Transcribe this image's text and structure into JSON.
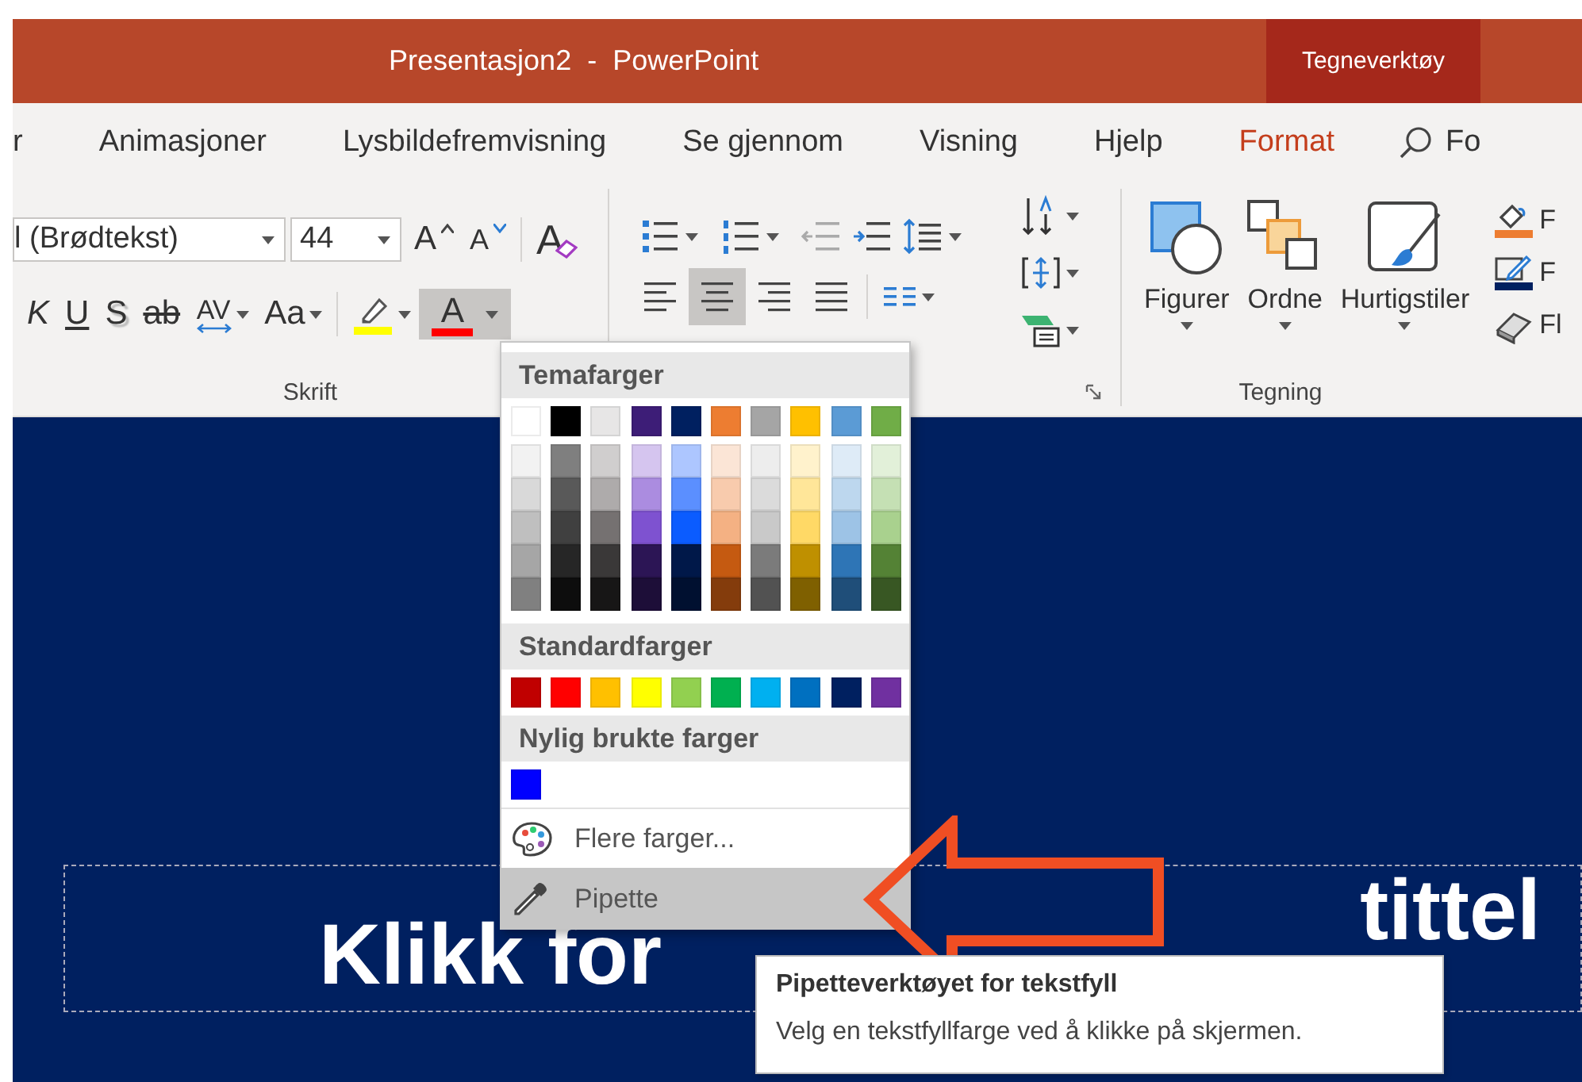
{
  "title_bar": {
    "title": "Presentasjon2  -  PowerPoint",
    "context_tab": "Tegneverktøy"
  },
  "tabs": [
    {
      "label": "r",
      "selected": false
    },
    {
      "label": "Animasjoner",
      "selected": false
    },
    {
      "label": "Lysbildefremvisning",
      "selected": false
    },
    {
      "label": "Se gjennom",
      "selected": false
    },
    {
      "label": "Visning",
      "selected": false
    },
    {
      "label": "Hjelp",
      "selected": false
    },
    {
      "label": "Format",
      "selected": true
    }
  ],
  "search": {
    "label": "Fo"
  },
  "font_group": {
    "label": "Skrift",
    "font_name": "l (Brødtekst)",
    "font_size": "44",
    "size_buttons": [
      {
        "kind": "grow",
        "text": "A"
      },
      {
        "kind": "shrink",
        "text": "A"
      }
    ],
    "clear_button": {
      "text": "A"
    },
    "format_buttons": [
      {
        "kind": "italic",
        "text": "K"
      },
      {
        "kind": "underline",
        "text": "U"
      },
      {
        "kind": "shadow",
        "text": "S"
      },
      {
        "kind": "strike",
        "text": "ab"
      },
      {
        "kind": "spacing",
        "text": "AV"
      },
      {
        "kind": "case",
        "text": "Aa"
      }
    ],
    "font_color_button": {
      "text": "A",
      "selected": true
    }
  },
  "paragraph_group": {
    "align_buttons": [
      {
        "kind": "left",
        "selected": false
      },
      {
        "kind": "center",
        "selected": true
      },
      {
        "kind": "right",
        "selected": false
      },
      {
        "kind": "justify",
        "selected": false
      }
    ]
  },
  "drawing_group": {
    "label": "Tegning",
    "buttons": [
      {
        "kind": "shapes",
        "label": "Figurer"
      },
      {
        "kind": "arrange",
        "label": "Ordne"
      },
      {
        "kind": "styles",
        "label": "Hurtigstiler"
      }
    ],
    "side_buttons": [
      {
        "kind": "fill",
        "label": "F"
      },
      {
        "kind": "outline",
        "label": "F"
      },
      {
        "kind": "effects",
        "label": "Fl"
      }
    ]
  },
  "color_menu": {
    "theme_header": "Temafarger",
    "theme_colors": [
      {
        "color": "#ffffff",
        "shades": [
          {
            "color": "#f2f2f2"
          },
          {
            "color": "#d9d9d9"
          },
          {
            "color": "#bfbfbf"
          },
          {
            "color": "#a6a6a6"
          },
          {
            "color": "#808080"
          }
        ]
      },
      {
        "color": "#000000",
        "shades": [
          {
            "color": "#7f7f7f"
          },
          {
            "color": "#595959"
          },
          {
            "color": "#404040"
          },
          {
            "color": "#262626"
          },
          {
            "color": "#0d0d0d"
          }
        ]
      },
      {
        "color": "#e7e6e6",
        "shades": [
          {
            "color": "#d0cece"
          },
          {
            "color": "#aeabab"
          },
          {
            "color": "#757171"
          },
          {
            "color": "#3a3838"
          },
          {
            "color": "#171616"
          }
        ]
      },
      {
        "color": "#3d1d77",
        "shades": [
          {
            "color": "#d5c5ef"
          },
          {
            "color": "#ab8ce0"
          },
          {
            "color": "#7e52d0"
          },
          {
            "color": "#2c1555"
          },
          {
            "color": "#1d0e38"
          }
        ]
      },
      {
        "color": "#002060",
        "shades": [
          {
            "color": "#adc6ff"
          },
          {
            "color": "#5b8fff"
          },
          {
            "color": "#0b5cff"
          },
          {
            "color": "#001849"
          },
          {
            "color": "#001030"
          }
        ]
      },
      {
        "color": "#ed7d31",
        "shades": [
          {
            "color": "#fbe5d6"
          },
          {
            "color": "#f8cbad"
          },
          {
            "color": "#f4b183"
          },
          {
            "color": "#c55a11"
          },
          {
            "color": "#843c0c"
          }
        ]
      },
      {
        "color": "#a5a5a5",
        "shades": [
          {
            "color": "#ededed"
          },
          {
            "color": "#dbdbdb"
          },
          {
            "color": "#c9c9c9"
          },
          {
            "color": "#7b7b7b"
          },
          {
            "color": "#525252"
          }
        ]
      },
      {
        "color": "#ffc000",
        "shades": [
          {
            "color": "#fff2cc"
          },
          {
            "color": "#ffe699"
          },
          {
            "color": "#ffd966"
          },
          {
            "color": "#bf9000"
          },
          {
            "color": "#7f6000"
          }
        ]
      },
      {
        "color": "#5b9bd5",
        "shades": [
          {
            "color": "#deebf7"
          },
          {
            "color": "#bdd7ee"
          },
          {
            "color": "#9dc3e6"
          },
          {
            "color": "#2e75b6"
          },
          {
            "color": "#1f4e79"
          }
        ]
      },
      {
        "color": "#70ad47",
        "shades": [
          {
            "color": "#e2f0d9"
          },
          {
            "color": "#c5e0b4"
          },
          {
            "color": "#a9d18e"
          },
          {
            "color": "#548235"
          },
          {
            "color": "#385723"
          }
        ]
      }
    ],
    "standard_header": "Standardfarger",
    "standard_colors": [
      {
        "color": "#c00000"
      },
      {
        "color": "#ff0000"
      },
      {
        "color": "#ffc000"
      },
      {
        "color": "#ffff00"
      },
      {
        "color": "#92d050"
      },
      {
        "color": "#00b050"
      },
      {
        "color": "#00b0f0"
      },
      {
        "color": "#0070c0"
      },
      {
        "color": "#002060"
      },
      {
        "color": "#7030a0"
      }
    ],
    "recent_header": "Nylig brukte farger",
    "recent_colors": [
      {
        "color": "#0000ff"
      }
    ],
    "items": [
      {
        "kind": "more",
        "label": "Flere farger...",
        "highlighted": false
      },
      {
        "kind": "eyedropper",
        "label": "Pipette",
        "highlighted": true
      }
    ]
  },
  "slide": {
    "title_parts": [
      "Klikk for",
      "tittel"
    ]
  },
  "tooltip": {
    "title": "Pipetteverktøyet for tekstfyll",
    "body": "Velg en tekstfyllfarge ved å klikke på skjermen."
  }
}
